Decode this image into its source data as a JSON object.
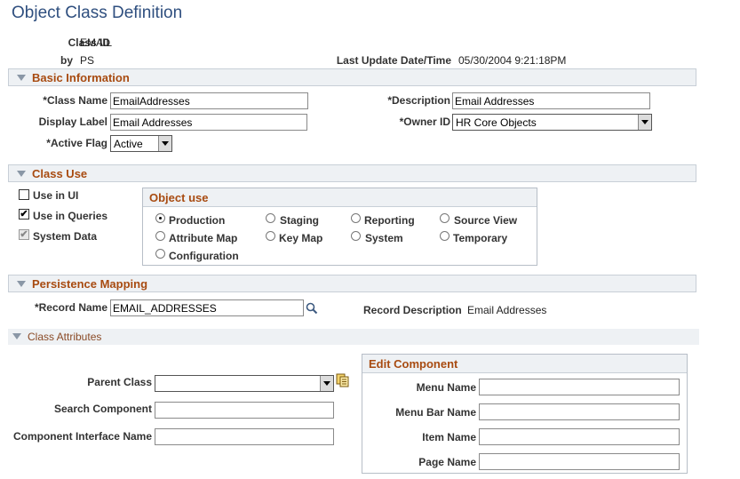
{
  "page": {
    "title": "Object Class Definition"
  },
  "header": {
    "class_id_label": "Class ID",
    "class_id_value": "EMAIL",
    "by_label": "by",
    "by_value": "PS",
    "last_update_label": "Last Update Date/Time",
    "last_update_value": "05/30/2004  9:21:18PM"
  },
  "basic_info": {
    "section_title": "Basic Information",
    "class_name_label": "*Class Name",
    "class_name_value": "EmailAddresses",
    "description_label": "*Description",
    "description_value": "Email Addresses",
    "display_label_label": "Display Label",
    "display_label_value": "Email Addresses",
    "owner_id_label": "*Owner ID",
    "owner_id_value": "HR Core Objects",
    "active_flag_label": "*Active Flag",
    "active_flag_value": "Active"
  },
  "class_use": {
    "section_title": "Class Use",
    "use_in_ui_label": "Use in UI",
    "use_in_ui_checked": false,
    "use_in_queries_label": "Use in Queries",
    "use_in_queries_checked": true,
    "system_data_label": "System Data",
    "system_data_checked": true,
    "check_mark": "✔",
    "object_use": {
      "title": "Object use",
      "options": [
        "Production",
        "Staging",
        "Reporting",
        "Source View",
        "Attribute Map",
        "Key Map",
        "System",
        "Temporary",
        "Configuration"
      ],
      "selected": "Production"
    }
  },
  "persistence": {
    "section_title": "Persistence Mapping",
    "record_name_label": "*Record Name",
    "record_name_value": "EMAIL_ADDRESSES",
    "record_desc_label": "Record Description",
    "record_desc_value": "Email Addresses"
  },
  "class_attributes": {
    "section_title": "Class Attributes",
    "parent_class_label": "Parent Class",
    "parent_class_value": "",
    "search_component_label": "Search Component",
    "search_component_value": "",
    "component_interface_label": "Component Interface Name",
    "component_interface_value": "",
    "edit_component": {
      "title": "Edit Component",
      "menu_name_label": "Menu Name",
      "menu_name_value": "",
      "menu_bar_name_label": "Menu Bar Name",
      "menu_bar_name_value": "",
      "item_name_label": "Item Name",
      "item_name_value": "",
      "page_name_label": "Page Name",
      "page_name_value": ""
    }
  },
  "icons": {
    "lookup": "magnifier-icon",
    "prompt": "prompt-list-icon"
  },
  "colors": {
    "title": "#2f4f7f",
    "section_title": "#a84b11",
    "section_bg": "#eef1f4"
  }
}
